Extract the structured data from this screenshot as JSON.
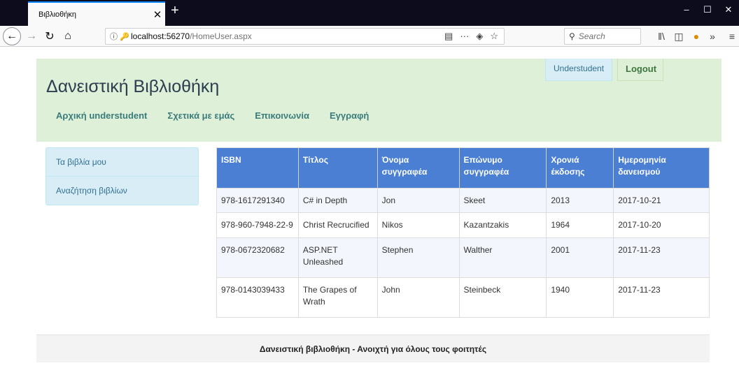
{
  "browser": {
    "tab_title": "Βιβλιοθήκη",
    "url_host": "localhost:56270",
    "url_path": "/HomeUser.aspx",
    "search_placeholder": "Search"
  },
  "header": {
    "site_title": "Δανειστική Βιβλιοθήκη",
    "nav": [
      "Αρχική understudent",
      "Σχετικά με εμάς",
      "Επικοινωνία",
      "Εγγραφή"
    ],
    "user_label": "Understudent",
    "logout_label": "Logout"
  },
  "sidebar": {
    "items": [
      "Τα βιβλία μου",
      "Αναζήτηση βιβλίων"
    ]
  },
  "table": {
    "columns": [
      "ISBN",
      "Τίτλος",
      "Όνομα συγγραφέα",
      "Επώνυμο συγγραφέα",
      "Χρονιά έκδοσης",
      "Ημερομηνία δανεισμού"
    ],
    "rows": [
      [
        "978-1617291340",
        "C# in Depth",
        "Jon",
        "Skeet",
        "2013",
        "2017-10-21"
      ],
      [
        "978-960-7948-22-9",
        "Christ Recrucified",
        "Nikos",
        "Kazantzakis",
        "1964",
        "2017-10-20"
      ],
      [
        "978-0672320682",
        "ASP.NET Unleashed",
        "Stephen",
        "Walther",
        "2001",
        "2017-11-23"
      ],
      [
        "978-0143039433",
        "The Grapes of Wrath",
        "John",
        "Steinbeck",
        "1940",
        "2017-11-23"
      ]
    ]
  },
  "footer": {
    "text": "Δανειστική βιβλιοθήκη - Ανοιχτή για όλους τους φοιτητές"
  },
  "colors": {
    "header_bg": "#dff0d8",
    "table_header_bg": "#4b7fd3",
    "sidebar_bg": "#d9edf7",
    "tab_accent": "#0a84ff"
  }
}
